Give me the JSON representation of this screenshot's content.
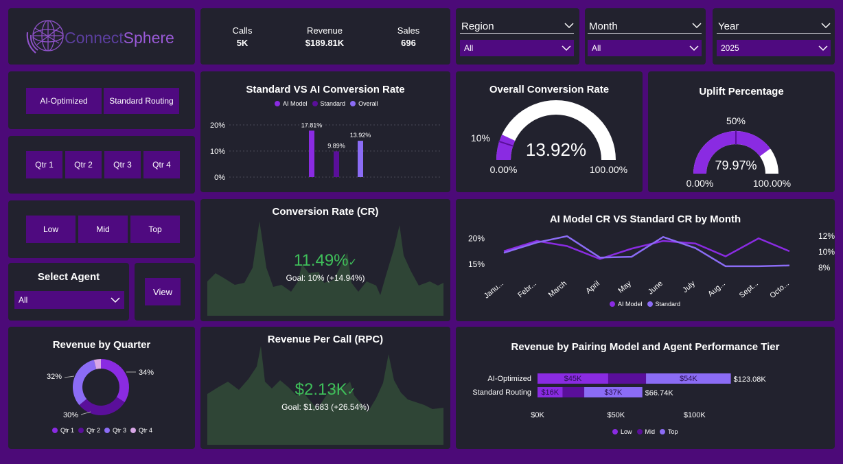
{
  "brand": {
    "name_part1": "Connect",
    "name_part2": "Sphere"
  },
  "kpis": [
    {
      "label": "Calls",
      "value": "5K"
    },
    {
      "label": "Revenue",
      "value": "$189.81K"
    },
    {
      "label": "Sales",
      "value": "696"
    }
  ],
  "filters": {
    "region": {
      "label": "Region",
      "value": "All"
    },
    "month": {
      "label": "Month",
      "value": "All"
    },
    "year": {
      "label": "Year",
      "value": "2025"
    }
  },
  "routing_buttons": [
    "AI-Optimized",
    "Standard Routing"
  ],
  "quarter_buttons": [
    "Qtr 1",
    "Qtr 2",
    "Qtr 3",
    "Qtr 4"
  ],
  "tier_buttons": [
    "Low",
    "Mid",
    "Top"
  ],
  "agent": {
    "title": "Select Agent",
    "value": "All",
    "view_label": "View"
  },
  "colors": {
    "ai": "#8a2be2",
    "standard": "#5a0f9a",
    "overall": "#8b6cf5",
    "qtr4": "#d8a6e6",
    "area": "#2f4536",
    "good": "#3fbf5a"
  },
  "conversion_chart": {
    "title": "Standard VS AI Conversion Rate",
    "legend": [
      "AI Model",
      "Standard",
      "Overall"
    ],
    "y_ticks": [
      "20%",
      "10%",
      "0%"
    ],
    "chart_data": {
      "type": "bar",
      "categories": [
        "AI Model",
        "Standard",
        "Overall"
      ],
      "values": [
        17.81,
        9.89,
        13.92
      ],
      "labels": [
        "17.81%",
        "9.89%",
        "13.92%"
      ],
      "ylim": [
        0,
        20
      ]
    }
  },
  "overall_gauge": {
    "title": "Overall Conversion Rate",
    "value": 13.92,
    "value_label": "13.92%",
    "target_label": "10%",
    "min_label": "0.00%",
    "max_label": "100.00%"
  },
  "uplift_gauge": {
    "title": "Uplift Percentage",
    "value": 79.97,
    "value_label": "79.97%",
    "target_label": "50%",
    "min_label": "0.00%",
    "max_label": "100.00%"
  },
  "cr_card": {
    "title": "Conversion Rate (CR)",
    "value": "11.49%",
    "goal": "Goal: 10% (+14.94%)"
  },
  "rpc_card": {
    "title": "Revenue Per Call (RPC)",
    "value": "$2.13K",
    "goal": "Goal: $1,683 (+26.54%)"
  },
  "monthly_chart": {
    "title": "AI Model CR VS Standard CR by Month",
    "left_ticks": [
      "20%",
      "15%"
    ],
    "right_ticks": [
      "12%",
      "10%",
      "8%"
    ],
    "month_labels": [
      "Janu...",
      "Febr...",
      "March",
      "April",
      "May",
      "June",
      "July",
      "Aug...",
      "Sept...",
      "Octo..."
    ],
    "legend": [
      "AI Model",
      "Standard"
    ],
    "chart_data": {
      "type": "line",
      "x": [
        "January",
        "February",
        "March",
        "April",
        "May",
        "June",
        "July",
        "August",
        "September",
        "October"
      ],
      "series": [
        {
          "name": "AI Model",
          "axis": "left",
          "values": [
            17.5,
            19.5,
            18.5,
            16,
            18,
            19.5,
            19,
            16.5,
            20,
            17.5
          ]
        },
        {
          "name": "Standard",
          "axis": "right",
          "values": [
            9.9,
            11.2,
            12,
            9.3,
            9.4,
            11.9,
            10.5,
            8.2,
            8.2,
            8.3
          ]
        }
      ],
      "left_ylim": [
        13.5,
        21.5
      ],
      "right_ylim": [
        7.5,
        12.7
      ]
    }
  },
  "quarter_donut": {
    "title": "Revenue by Quarter",
    "legend": [
      "Qtr 1",
      "Qtr 2",
      "Qtr 3",
      "Qtr 4"
    ],
    "labels": [
      "34%",
      "30%",
      "32%"
    ],
    "chart_data": {
      "type": "pie",
      "categories": [
        "Qtr 1",
        "Qtr 2",
        "Qtr 3",
        "Qtr 4"
      ],
      "values": [
        34,
        30,
        32,
        4
      ]
    }
  },
  "pairing_chart": {
    "title": "Revenue by Pairing Model and Agent Performance Tier",
    "legend": [
      "Low",
      "Mid",
      "Top"
    ],
    "x_ticks": [
      "$0K",
      "$50K",
      "$100K"
    ],
    "chart_data": {
      "type": "bar",
      "orientation": "horizontal-stacked",
      "categories": [
        "AI-Optimized",
        "Standard Routing"
      ],
      "series": [
        {
          "name": "Low",
          "values": [
            45,
            16
          ]
        },
        {
          "name": "Mid",
          "values": [
            24.08,
            13.74
          ]
        },
        {
          "name": "Top",
          "values": [
            54,
            37
          ]
        }
      ],
      "segment_labels": [
        [
          "$45K",
          "",
          "$54K"
        ],
        [
          "$16K",
          "",
          "$37K"
        ]
      ],
      "totals": [
        "$123.08K",
        "$66.74K"
      ],
      "xlim": [
        0,
        125
      ]
    }
  }
}
